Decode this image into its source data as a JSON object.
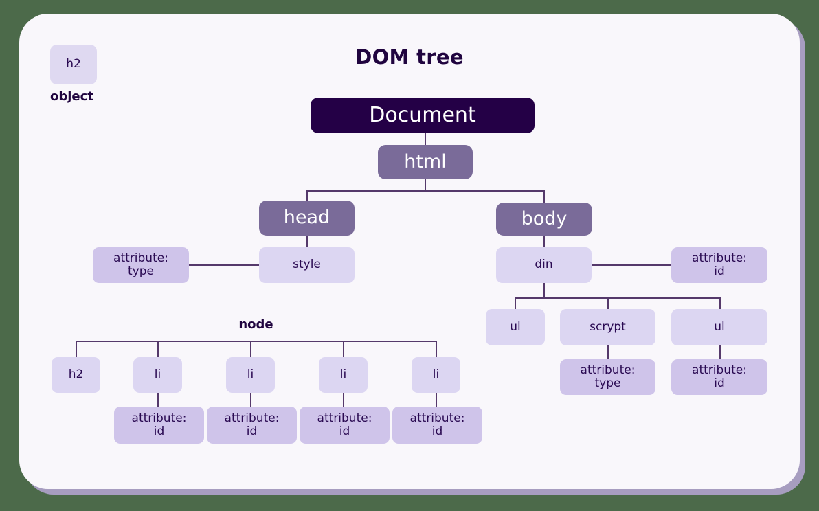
{
  "page": {
    "background_color": "#4c6a4a",
    "card_color": "#f9f7fb",
    "shadow_color": "#a79dc0"
  },
  "diagram": {
    "title": "DOM tree",
    "legend": {
      "sample_label": "h2",
      "caption": "object"
    },
    "section_caption": "node",
    "colors": {
      "document_box": "#240046",
      "element_box": "#7a6b99",
      "sub_box": "#dcd6f2",
      "attribute_box": "#cfc4ea",
      "connector": "#55396b",
      "text_dark": "#2a0a52",
      "text_light": "#ffffff"
    },
    "nodes": {
      "document": "Document",
      "html": "html",
      "head": "head",
      "body": "body",
      "style": "style",
      "style_attribute": "attribute:\ntype",
      "din": "din",
      "din_attribute": "attribute:\nid",
      "ul_left": "ul",
      "scrypt": "scrypt",
      "scrypt_attribute": "attribute:\ntype",
      "ul_right": "ul",
      "ul_right_attribute": "attribute:\nid",
      "node_children": [
        {
          "label": "h2",
          "attribute": null
        },
        {
          "label": "li",
          "attribute": "attribute:\nid"
        },
        {
          "label": "li",
          "attribute": "attribute:\nid"
        },
        {
          "label": "li",
          "attribute": "attribute:\nid"
        },
        {
          "label": "li",
          "attribute": "attribute:\nid"
        }
      ]
    }
  }
}
